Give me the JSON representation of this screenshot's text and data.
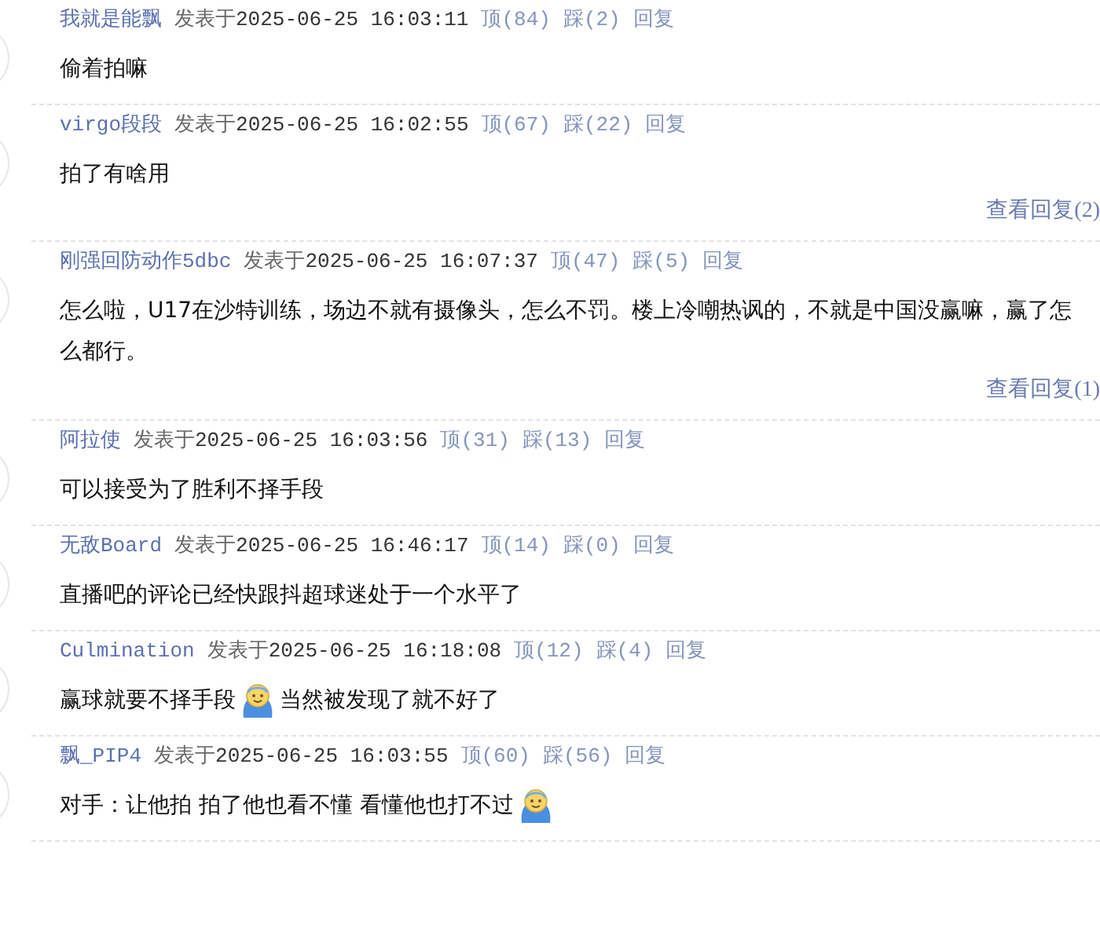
{
  "comments": [
    {
      "author": "我就是能飘",
      "posted": "发表于",
      "time": "2025-06-25 16:03:11",
      "up": "顶(84)",
      "down": "踩(2)",
      "reply": "回复",
      "body": [
        {
          "kind": "text",
          "text": "偷着拍嘛"
        }
      ]
    },
    {
      "author": "virgo段段",
      "posted": "发表于",
      "time": "2025-06-25 16:02:55",
      "up": "顶(67)",
      "down": "踩(22)",
      "reply": "回复",
      "body": [
        {
          "kind": "text",
          "text": "拍了有啥用"
        }
      ],
      "view_replies": "查看回复(2)"
    },
    {
      "author": "刚强回防动作5dbc",
      "posted": "发表于",
      "time": "2025-06-25 16:07:37",
      "up": "顶(47)",
      "down": "踩(5)",
      "reply": "回复",
      "body": [
        {
          "kind": "text",
          "text": "怎么啦，U17在沙特训练，场边不就有摄像头，怎么不罚。楼上冷嘲热讽的，不就是中国没赢嘛，赢了怎么都行。"
        }
      ],
      "view_replies": "查看回复(1)"
    },
    {
      "author": "阿拉使",
      "posted": "发表于",
      "time": "2025-06-25 16:03:56",
      "up": "顶(31)",
      "down": "踩(13)",
      "reply": "回复",
      "body": [
        {
          "kind": "text",
          "text": "可以接受为了胜利不择手段"
        }
      ]
    },
    {
      "author": "无敌Board",
      "posted": "发表于",
      "time": "2025-06-25 16:46:17",
      "up": "顶(14)",
      "down": "踩(0)",
      "reply": "回复",
      "body": [
        {
          "kind": "text",
          "text": "直播吧的评论已经快跟抖超球迷处于一个水平了"
        }
      ]
    },
    {
      "author": "Culmination",
      "posted": "发表于",
      "time": "2025-06-25 16:18:08",
      "up": "顶(12)",
      "down": "踩(4)",
      "reply": "回复",
      "body": [
        {
          "kind": "text",
          "text": "赢球就要不择手段"
        },
        {
          "kind": "emoji"
        },
        {
          "kind": "text",
          "text": "当然被发现了就不好了"
        }
      ]
    },
    {
      "author": "飘_PIP4",
      "posted": "发表于",
      "time": "2025-06-25 16:03:55",
      "up": "顶(60)",
      "down": "踩(56)",
      "reply": "回复",
      "body": [
        {
          "kind": "text",
          "text": "对手：让他拍 拍了他也看不懂 看懂他也打不过"
        },
        {
          "kind": "emoji"
        }
      ]
    }
  ]
}
